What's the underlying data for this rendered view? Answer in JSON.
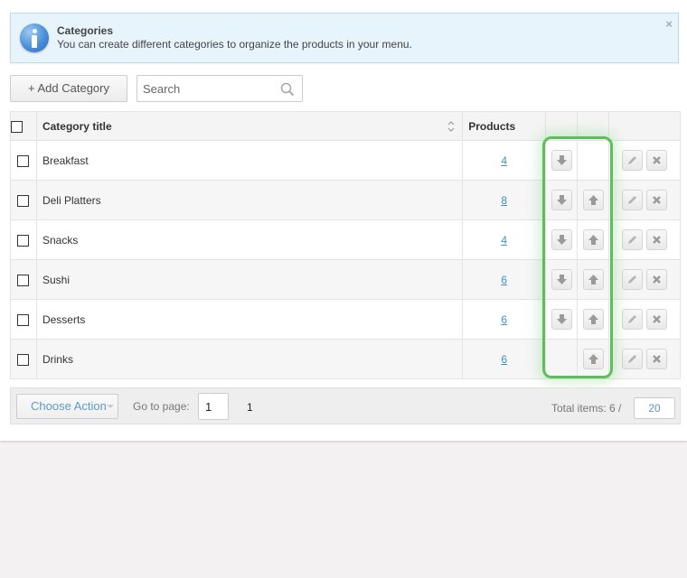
{
  "info": {
    "title": "Categories",
    "text": "You can create different categories to organize the products in your menu.",
    "close": "×",
    "icon": "info-icon"
  },
  "toolbar": {
    "add_label": "+ Add Category",
    "search_placeholder": "Search"
  },
  "table": {
    "headers": {
      "title": "Category title",
      "products": "Products"
    },
    "rows": [
      {
        "title": "Breakfast",
        "products": "4",
        "move_down": true,
        "move_up": false
      },
      {
        "title": "Deli Platters",
        "products": "8",
        "move_down": true,
        "move_up": true
      },
      {
        "title": "Snacks",
        "products": "4",
        "move_down": true,
        "move_up": true
      },
      {
        "title": "Sushi",
        "products": "6",
        "move_down": true,
        "move_up": true
      },
      {
        "title": "Desserts",
        "products": "6",
        "move_down": true,
        "move_up": true
      },
      {
        "title": "Drinks",
        "products": "6",
        "move_down": false,
        "move_up": true
      }
    ]
  },
  "footer": {
    "choose_action": "Choose Action",
    "goto_label": "Go to page:",
    "goto_value": "1",
    "total_pages": "1",
    "total_items": "Total items: 6 /",
    "per_page": "20"
  },
  "colors": {
    "link": "#3d8fc6",
    "highlight": "#5cbf5c",
    "info_bg": "#e8f4fb"
  }
}
